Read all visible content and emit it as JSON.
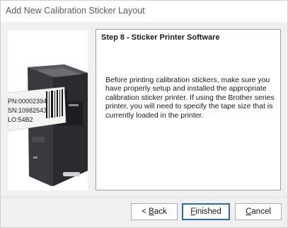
{
  "window": {
    "title": "Add New Calibration Sticker Layout"
  },
  "image": {
    "icon": "printer-illustration",
    "label_lines": [
      "PN:00002394",
      "SN:10982543",
      "LO:54B2"
    ]
  },
  "step": {
    "title": "Step 8 - Sticker Printer Software",
    "body": "Before printing calibration stickers, make sure you have properly setup and installed the appropriate calibration sticker printer.  If using the Brother series printer, you will need to specify the tape size that is currently loaded in the printer."
  },
  "buttons": {
    "back_prefix": "< ",
    "back_mnemonic": "B",
    "back_rest": "ack",
    "finished_mnemonic": "F",
    "finished_rest": "inished",
    "cancel_mnemonic": "C",
    "cancel_rest": "ancel"
  },
  "colors": {
    "accent_border": "#2a6bb5",
    "window_bg": "#f0f0f0",
    "panel_border": "#a0a0a0"
  }
}
